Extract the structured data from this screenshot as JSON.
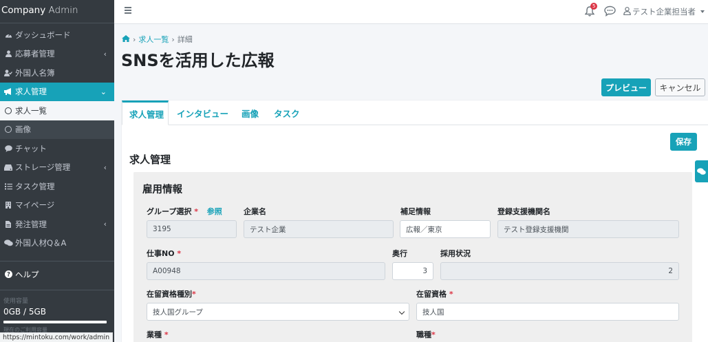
{
  "brand": {
    "name_bold": "Company",
    "name_light": "Admin"
  },
  "sidebar": {
    "items": [
      {
        "label": "ダッシュボード",
        "icon": "dashboard-icon"
      },
      {
        "label": "応募者管理",
        "icon": "user-icon",
        "has_children": true
      },
      {
        "label": "外国人名簿",
        "icon": "user-check-icon"
      },
      {
        "label": "求人管理",
        "icon": "megaphone-icon",
        "has_children": true,
        "expanded": true
      },
      {
        "label": "求人一覧",
        "icon": "circle-icon"
      },
      {
        "label": "画像",
        "icon": "circle-icon"
      },
      {
        "label": "チャット",
        "icon": "comment-icon"
      },
      {
        "label": "ストレージ管理",
        "icon": "hdd-icon",
        "has_children": true
      },
      {
        "label": "タスク管理",
        "icon": "tasks-icon"
      },
      {
        "label": "マイページ",
        "icon": "building-icon"
      },
      {
        "label": "発注管理",
        "icon": "file-icon",
        "has_children": true
      },
      {
        "label": "外国人材Q＆A",
        "icon": "comments-icon"
      }
    ],
    "help_label": "ヘルプ",
    "usage_label": "使用容量",
    "usage_value": "0GB / 5GB",
    "usage_note": "現在のご利用容量"
  },
  "status_url": "https://mintoku.com/work/admin",
  "topbar": {
    "notification_count": "5",
    "user_name": "テスト企業担当者"
  },
  "breadcrumb": {
    "level1": "求人一覧",
    "level2": "詳細"
  },
  "page_title": "SNSを活用した広報",
  "buttons": {
    "preview": "プレビュー",
    "cancel": "キャンセル",
    "save": "保存"
  },
  "tabs": [
    "求人管理",
    "インタビュー",
    "画像",
    "タスク"
  ],
  "section_title": "求人管理",
  "panel_title": "雇用情報",
  "form": {
    "group_label": "グループ選択",
    "group_ref": "参照",
    "group_value": "3195",
    "company_label": "企業名",
    "company_value": "テスト企業",
    "supplement_label": "補足情報",
    "supplement_value": "広報／東京",
    "agency_label": "登録支援機関名",
    "agency_value": "テスト登録支援機関",
    "job_no_label": "仕事NO",
    "job_no_value": "A00948",
    "depth_label": "奥行",
    "depth_value": "3",
    "hiring_label": "採用状況",
    "hiring_value": "2",
    "residence_type_label": "在留資格種別",
    "residence_type_value": "技人国グループ",
    "residence_label": "在留資格",
    "residence_value": "技人国",
    "industry_label": "業種",
    "job_type_label": "職種"
  },
  "colors": {
    "accent": "#17a2b8",
    "sidebar": "#343a40",
    "required": "#dc3545"
  }
}
